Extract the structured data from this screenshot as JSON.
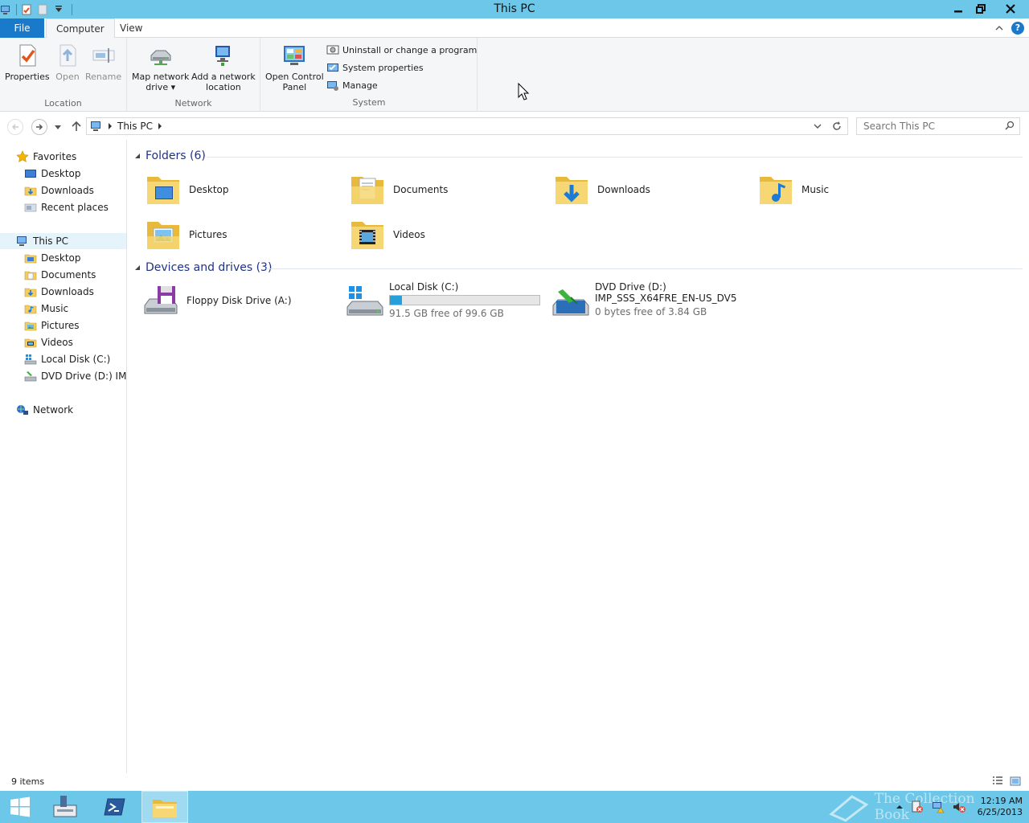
{
  "window": {
    "title": "This PC"
  },
  "ribbon": {
    "tabs": {
      "file": "File",
      "computer": "Computer",
      "view": "View"
    },
    "location": {
      "label": "Location",
      "properties": "Properties",
      "open": "Open",
      "rename": "Rename"
    },
    "network": {
      "label": "Network",
      "map_drive_line1": "Map network",
      "map_drive_line2": "drive",
      "add_location_line1": "Add a network",
      "add_location_line2": "location"
    },
    "system": {
      "label": "System",
      "control_panel_line1": "Open Control",
      "control_panel_line2": "Panel",
      "uninstall": "Uninstall or change a program",
      "system_properties": "System properties",
      "manage": "Manage"
    }
  },
  "address": {
    "crumb": "This PC",
    "search_placeholder": "Search This PC"
  },
  "navpane": {
    "favorites": "Favorites",
    "fav_items": [
      "Desktop",
      "Downloads",
      "Recent places"
    ],
    "this_pc": "This PC",
    "pc_items": [
      "Desktop",
      "Documents",
      "Downloads",
      "Music",
      "Pictures",
      "Videos",
      "Local Disk (C:)",
      "DVD Drive (D:) IMP_S"
    ],
    "network": "Network"
  },
  "content": {
    "folders_header": "Folders (6)",
    "folders": [
      "Desktop",
      "Documents",
      "Downloads",
      "Music",
      "Pictures",
      "Videos"
    ],
    "drives_header": "Devices and drives (3)",
    "floppy": "Floppy Disk Drive (A:)",
    "local_disk": {
      "name": "Local Disk (C:)",
      "free": "91.5 GB free of 99.6 GB",
      "used_fraction": 0.08
    },
    "dvd": {
      "name": "DVD Drive (D:)",
      "label": "IMP_SSS_X64FRE_EN-US_DV5",
      "free": "0 bytes free of 3.84 GB"
    }
  },
  "status": {
    "count": "9 items"
  },
  "taskbar": {
    "time": "12:19 AM",
    "date": "6/25/2013",
    "watermark": "The Collection Book"
  },
  "colors": {
    "title_bar": "#6cc7e8",
    "file_tab": "#1979ca",
    "group_header": "#1e3287",
    "progress": "#26a0da"
  }
}
